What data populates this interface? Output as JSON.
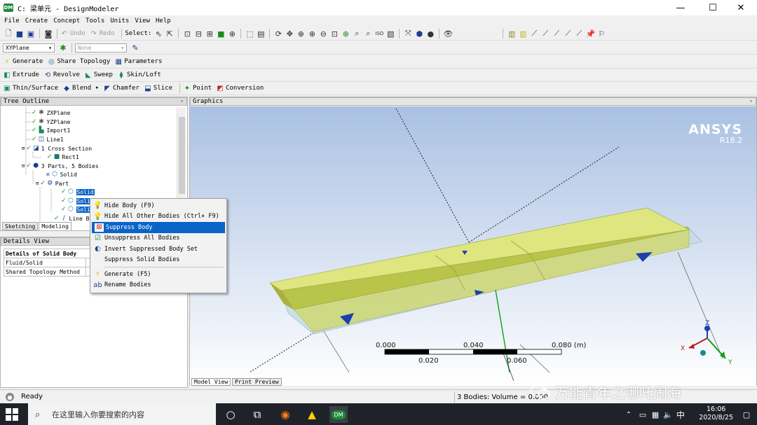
{
  "window": {
    "logo_text": "DM",
    "title": "C: 梁单元 - DesignModeler",
    "minimize": "—",
    "maximize": "☐",
    "close": "✕"
  },
  "menu": [
    "File",
    "Create",
    "Concept",
    "Tools",
    "Units",
    "View",
    "Help"
  ],
  "toolbar1": {
    "undo": "Undo",
    "redo": "Redo",
    "select_label": "Select:"
  },
  "toolbar2": {
    "plane_value": "XYPlane",
    "sketch_value": "None"
  },
  "toolbar3": {
    "generate": "Generate",
    "share_topology": "Share Topology",
    "parameters": "Parameters"
  },
  "toolbar4": {
    "extrude": "Extrude",
    "revolve": "Revolve",
    "sweep": "Sweep",
    "skin_loft": "Skin/Loft"
  },
  "toolbar5": {
    "thin_surface": "Thin/Surface",
    "blend": "Blend ▾",
    "chamfer": "Chamfer",
    "slice": "Slice",
    "point": "Point",
    "conversion": "Conversion"
  },
  "tree_outline": {
    "title": "Tree Outline",
    "pin": "ᵠ",
    "items": [
      {
        "label": "ZXPlane"
      },
      {
        "label": "YZPlane"
      },
      {
        "label": "Import1"
      },
      {
        "label": "Line1"
      },
      {
        "label": "1 Cross Section"
      },
      {
        "label": "Rect1"
      },
      {
        "label": "3 Parts, 5 Bodies"
      },
      {
        "label": "Solid"
      },
      {
        "label": "Part"
      },
      {
        "label": "Solid"
      },
      {
        "label": "Solid"
      },
      {
        "label": "Solid"
      },
      {
        "label": "Line Body"
      }
    ],
    "tabs": [
      "Sketching",
      "Modeling"
    ]
  },
  "details_view": {
    "title": "Details View",
    "header": "Details of Solid Body",
    "rows": [
      {
        "label": "Fluid/Solid"
      },
      {
        "label": "Shared Topology Method"
      }
    ]
  },
  "graphics": {
    "title": "Graphics",
    "brand": "ANSYS",
    "version": "R18.2",
    "scale_labels": [
      "0.000",
      "0.040",
      "0.080 (m)",
      "0.020",
      "0.060"
    ],
    "tabs": [
      "Model View",
      "Print Preview"
    ],
    "triad": {
      "x": "X",
      "y": "Y",
      "z": "Z"
    }
  },
  "context_menu": {
    "items": [
      {
        "label": "Hide Body (F9)"
      },
      {
        "label": "Hide All Other Bodies (Ctrl+ F9)"
      },
      {
        "label": "Suppress Body"
      },
      {
        "label": "Unsuppress All Bodies"
      },
      {
        "label": "Invert Suppressed Body Set"
      },
      {
        "label": "Suppress Solid Bodies"
      },
      {
        "label": "Generate (F5)"
      },
      {
        "label": "Rename Bodies"
      }
    ]
  },
  "status": {
    "ready": "Ready",
    "bodies": "3 Bodies: Volume = 0.000"
  },
  "taskbar": {
    "search_placeholder": "在这里输入你要搜索的内容",
    "time": "16:06",
    "date": "2020/8/25",
    "ime": "中"
  },
  "watermark": "万能青年之哪吒闹海"
}
